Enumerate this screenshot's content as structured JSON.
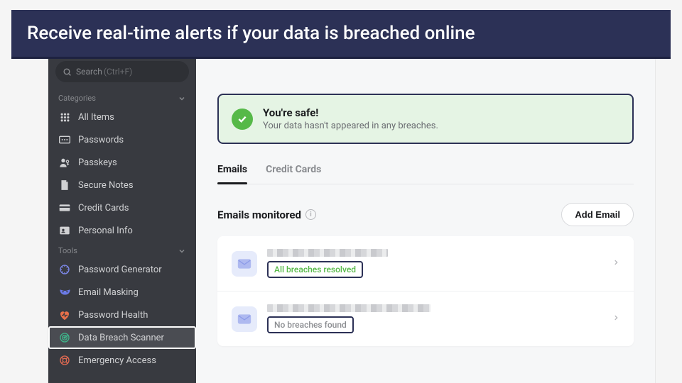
{
  "banner": "Receive real-time alerts if your data is breached online",
  "search": {
    "label": "Search",
    "shortcut": "(Ctrl+F)"
  },
  "sections": {
    "categories": "Categories",
    "tools": "Tools"
  },
  "nav": {
    "categories": [
      {
        "label": "All Items"
      },
      {
        "label": "Passwords"
      },
      {
        "label": "Passkeys"
      },
      {
        "label": "Secure Notes"
      },
      {
        "label": "Credit Cards"
      },
      {
        "label": "Personal Info"
      }
    ],
    "tools": [
      {
        "label": "Password Generator"
      },
      {
        "label": "Email Masking"
      },
      {
        "label": "Password Health"
      },
      {
        "label": "Data Breach Scanner"
      },
      {
        "label": "Emergency Access"
      }
    ]
  },
  "safe": {
    "title": "You're safe!",
    "subtitle": "Your data hasn't appeared in any breaches."
  },
  "tabs": [
    {
      "label": "Emails"
    },
    {
      "label": "Credit Cards"
    }
  ],
  "monitored": {
    "title": "Emails monitored",
    "add": "Add Email"
  },
  "emails": [
    {
      "status": "All breaches resolved",
      "statusClass": "green"
    },
    {
      "status": "No breaches found",
      "statusClass": "gray"
    }
  ]
}
